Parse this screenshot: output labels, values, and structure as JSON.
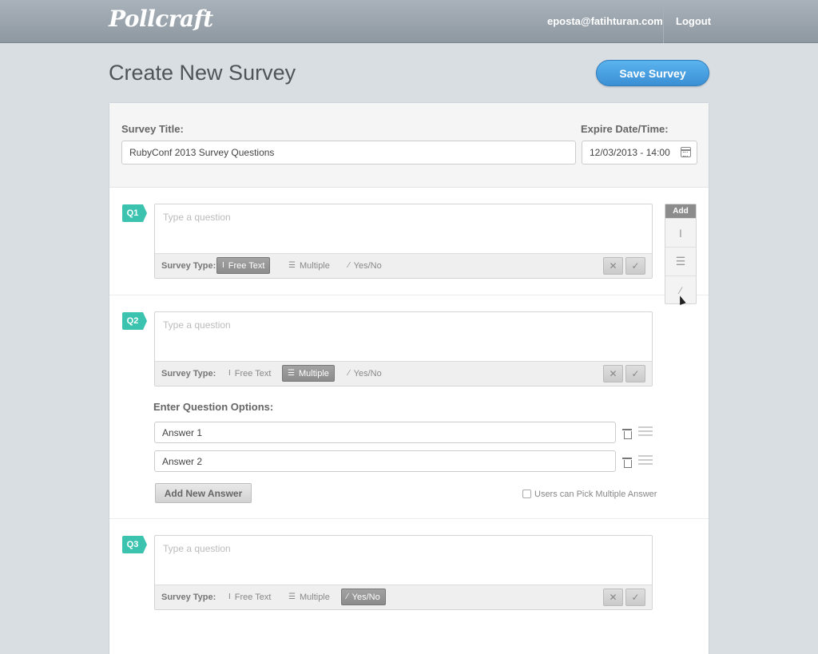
{
  "header": {
    "logo": "Pollcraft",
    "email": "eposta@fatihturan.com",
    "logout": "Logout"
  },
  "page": {
    "title": "Create New Survey",
    "save_label": "Save Survey"
  },
  "form": {
    "title_label": "Survey Title:",
    "title_value": "RubyConf 2013 Survey Questions",
    "expire_label": "Expire Date/Time:",
    "expire_value": "12/03/2013 - 14:00"
  },
  "survey_type_label": "Survey Type:",
  "type_options": {
    "free_text": "Free Text",
    "multiple": "Multiple",
    "yes_no": "Yes/No"
  },
  "question_placeholder": "Type a question",
  "questions": [
    {
      "tag": "Q1",
      "selected": "free_text"
    },
    {
      "tag": "Q2",
      "selected": "multiple"
    },
    {
      "tag": "Q3",
      "selected": "yes_no"
    }
  ],
  "add_panel": {
    "label": "Add"
  },
  "options_section": {
    "label": "Enter Question Options:",
    "answers": [
      "Answer 1",
      "Answer 2"
    ],
    "add_label": "Add New Answer",
    "multi_label": "Users can Pick Multiple Answer"
  },
  "colors": {
    "accent": "#3cc3b0",
    "save": "#3a8fd4",
    "topbar": "#9aa3ab",
    "background": "#d9dee2"
  }
}
